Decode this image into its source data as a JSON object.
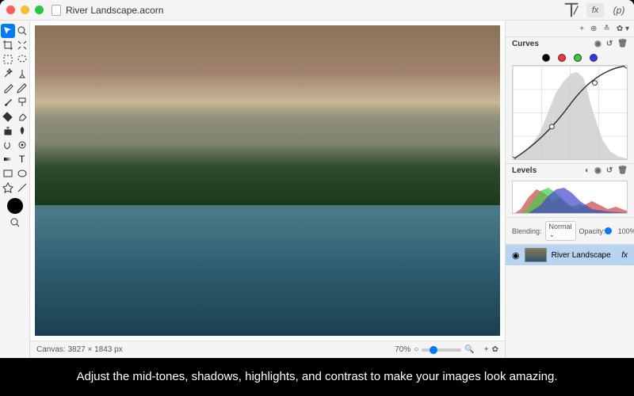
{
  "titlebar": {
    "filename": "River Landscape.acorn",
    "fx_label": "fx",
    "p_label": "p"
  },
  "status": {
    "canvas_label": "Canvas: 3827 × 1843 px",
    "zoom_pct": "70%"
  },
  "curves": {
    "header": "Curves",
    "channels": [
      "rgb",
      "red",
      "green",
      "blue"
    ]
  },
  "levels": {
    "header": "Levels"
  },
  "blending": {
    "label": "Blending:",
    "mode": "Normal",
    "opacity_label": "Opacity:",
    "opacity_value": "100%"
  },
  "layers": [
    {
      "name": "River Landscape",
      "visible": true,
      "fx": "fx"
    }
  ],
  "tools": {
    "move": "move-tool",
    "zoom": "zoom-tool",
    "crop": "crop-tool",
    "select": "select-tool",
    "lasso": "lasso-tool",
    "wand": "wand-tool",
    "eyedropper": "eyedropper-tool",
    "brush": "brush-tool",
    "pencil": "pencil-tool",
    "eraser": "eraser-tool",
    "fill": "fill-tool",
    "gradient": "gradient-tool",
    "clone": "clone-tool",
    "blur": "blur-tool",
    "shape": "shape-tool",
    "text": "text-tool",
    "rect": "rect-tool",
    "ellipse": "ellipse-tool",
    "star": "star-tool",
    "line": "line-tool"
  },
  "caption": "Adjust the mid-tones, shadows, highlights, and contrast to make your images look amazing."
}
